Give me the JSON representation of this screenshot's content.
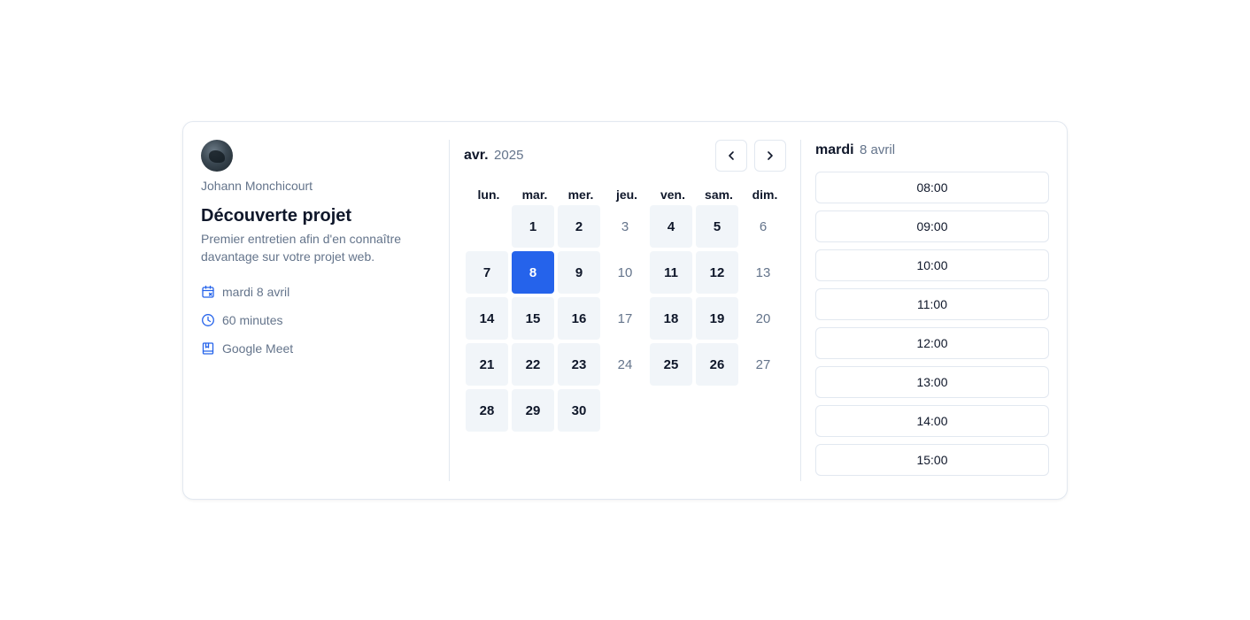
{
  "host": {
    "name": "Johann Monchicourt"
  },
  "event": {
    "title": "Découverte projet",
    "description": "Premier entretien afin d'en connaître davantage sur votre projet web.",
    "meta": {
      "date": "mardi 8 avril",
      "duration": "60 minutes",
      "location": "Google Meet"
    }
  },
  "calendar": {
    "month": "avr.",
    "year": "2025",
    "weekdays": [
      "lun.",
      "mar.",
      "mer.",
      "jeu.",
      "ven.",
      "sam.",
      "dim."
    ],
    "first_weekday_index": 1,
    "days_in_month": 30,
    "selected_day": 8,
    "available_days": [
      1,
      2,
      4,
      5,
      7,
      8,
      9,
      11,
      12,
      14,
      15,
      16,
      18,
      19,
      21,
      22,
      23,
      25,
      26,
      28,
      29,
      30
    ]
  },
  "slots": {
    "day_name": "mardi",
    "date": "8 avril",
    "times": [
      "08:00",
      "09:00",
      "10:00",
      "11:00",
      "12:00",
      "13:00",
      "14:00",
      "15:00"
    ]
  },
  "colors": {
    "accent": "#2563eb",
    "available_bg": "#f1f5f9",
    "muted_text": "#64748b",
    "border": "#e2e8f0"
  },
  "icons": {
    "date": "calendar-icon",
    "duration": "clock-icon",
    "location": "video-location-icon",
    "prev": "chevron-left-icon",
    "next": "chevron-right-icon"
  }
}
